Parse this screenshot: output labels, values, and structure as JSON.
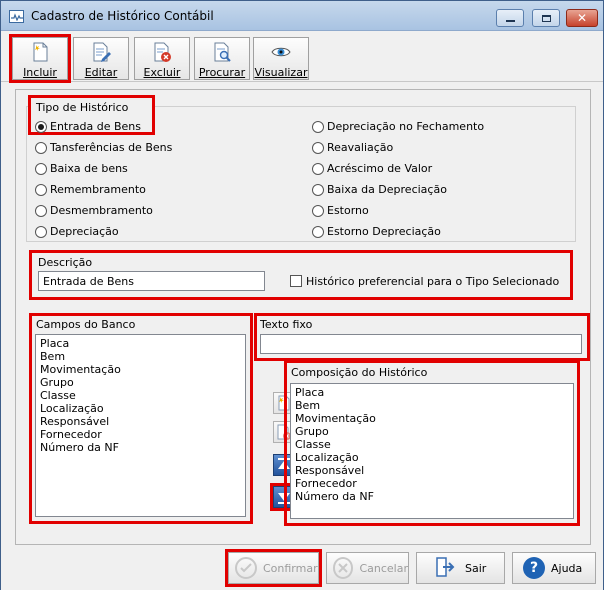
{
  "window": {
    "title": "Cadastro de Histórico Contábil",
    "controls": [
      "minimize",
      "maximize",
      "close"
    ]
  },
  "toolbar": {
    "buttons": [
      {
        "label": "Incluir",
        "icon": "new-document-icon"
      },
      {
        "label": "Editar",
        "icon": "edit-document-icon"
      },
      {
        "label": "Excluir",
        "icon": "delete-document-icon"
      },
      {
        "label": "Procurar",
        "icon": "search-document-icon"
      },
      {
        "label": "Visualizar",
        "icon": "eye-icon"
      }
    ]
  },
  "tipo": {
    "legend": "Tipo de Histórico",
    "selected": "Entrada de Bens",
    "left": [
      "Entrada de Bens",
      "Tansferências de Bens",
      "Baixa de bens",
      "Remembramento",
      "Desmembramento",
      "Depreciação"
    ],
    "right": [
      "Depreciação no Fechamento",
      "Reavaliação",
      "Acréscimo de Valor",
      "Baixa da Depreciação",
      "Estorno",
      "Estorno Depreciação"
    ]
  },
  "descricao": {
    "label": "Descrição",
    "value": "Entrada de Bens",
    "checkbox_label": "Histórico preferencial para o Tipo Selecionado",
    "checked": false
  },
  "campos": {
    "label": "Campos do Banco",
    "items": [
      "Placa",
      "Bem",
      "Movimentação",
      "Grupo",
      "Classe",
      "Localização",
      "Responsável",
      "Fornecedor",
      "Número da NF"
    ]
  },
  "texto_fixo": {
    "label": "Texto fixo",
    "value": ""
  },
  "composicao": {
    "label": "Composição do Histórico",
    "items": [
      "Placa",
      "Bem",
      "Movimentação",
      "Grupo",
      "Classe",
      "Localização",
      "Responsável",
      "Fornecedor",
      "Número da NF"
    ]
  },
  "footer": {
    "confirmar": "Confirmar",
    "cancelar": "Cancelar",
    "sair": "Sair",
    "ajuda": "Ajuda"
  },
  "colors": {
    "highlight": "#e10000",
    "titlebar": "#a9c3e2",
    "accent": "#23539c"
  }
}
